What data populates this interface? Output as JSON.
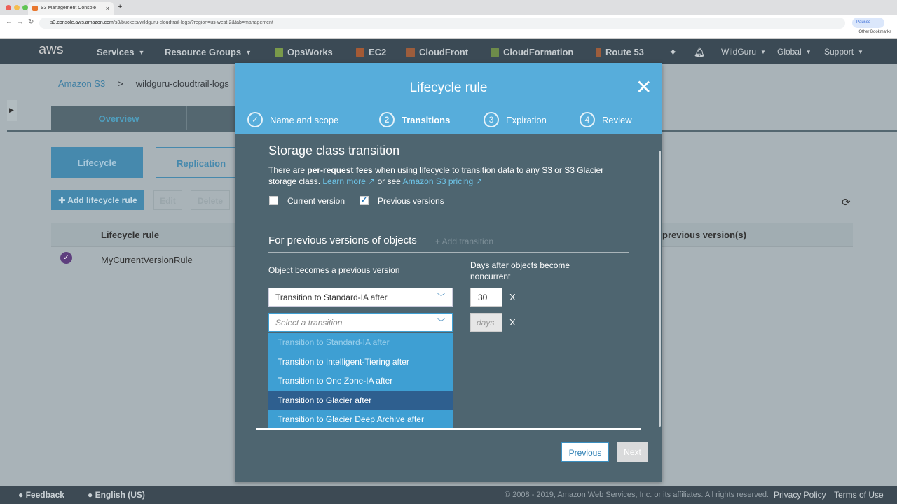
{
  "browser": {
    "tab_title": "S3 Management Console",
    "url_host": "s3.console.aws.amazon.com",
    "url_path": "/s3/buckets/wildguru-cloudtrail-logs/?region=us-west-2&tab=management",
    "paused": "Paused",
    "other_bookmarks": "Other Bookmarks"
  },
  "nav": {
    "logo": "aws",
    "services": "Services",
    "resource_groups": "Resource Groups",
    "shortcuts": [
      "OpsWorks",
      "EC2",
      "CloudFront",
      "CloudFormation",
      "Route 53"
    ],
    "user": "WildGuru",
    "region": "Global",
    "support": "Support"
  },
  "page": {
    "breadcrumb_root": "Amazon S3",
    "breadcrumb_bucket": "wildguru-cloudtrail-logs",
    "tab_overview": "Overview",
    "subtab_lifecycle": "Lifecycle",
    "subtab_replication": "Replication",
    "add_rule": "Add lifecycle rule",
    "edit": "Edit",
    "delete": "Delete",
    "col_rule": "Lifecycle rule",
    "col_prev": "previous version(s)",
    "rows": [
      {
        "name": "MyCurrentVersionRule"
      }
    ]
  },
  "modal": {
    "title": "Lifecycle rule",
    "steps": [
      {
        "num": "✓",
        "label": "Name and scope"
      },
      {
        "num": "2",
        "label": "Transitions"
      },
      {
        "num": "3",
        "label": "Expiration"
      },
      {
        "num": "4",
        "label": "Review"
      }
    ],
    "section_title": "Storage class transition",
    "para_pre": "There are ",
    "para_bold": "per-request fees",
    "para_mid": " when using lifecycle to transition data to any S3 or S3 Glacier storage class. ",
    "learn_more": "Learn more ↗",
    "or_see": " or see ",
    "pricing": "Amazon S3 pricing ↗",
    "cb_current": "Current version",
    "cb_current_checked": false,
    "cb_previous": "Previous versions",
    "cb_previous_checked": true,
    "prev_title": "For previous versions of objects",
    "add_transition": "+ Add transition",
    "col_object": "Object becomes a previous version",
    "col_days": "Days after objects become noncurrent",
    "row1_select": "Transition to Standard-IA after",
    "row1_days": "30",
    "row2_placeholder": "Select a transition",
    "row2_days_placeholder": "days",
    "remove": "X",
    "options": [
      "Transition to Standard-IA after",
      "Transition to Intelligent-Tiering after",
      "Transition to One Zone-IA after",
      "Transition to Glacier after",
      "Transition to Glacier Deep Archive after"
    ],
    "previous": "Previous",
    "next": "Next"
  },
  "footer": {
    "feedback": "Feedback",
    "language": "English (US)",
    "copyright": "© 2008 - 2019, Amazon Web Services, Inc. or its affiliates. All rights reserved.",
    "privacy": "Privacy Policy",
    "terms": "Terms of Use"
  }
}
